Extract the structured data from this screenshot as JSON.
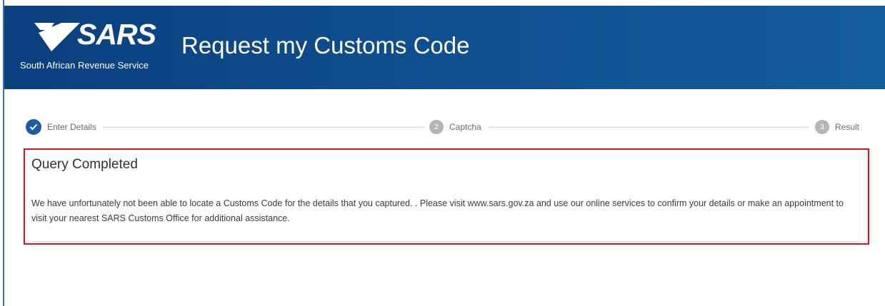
{
  "header": {
    "logo_text": "SARS",
    "org_name": "South African Revenue Service",
    "title": "Request my Customs Code"
  },
  "stepper": {
    "steps": [
      {
        "label": "Enter Details",
        "marker": "",
        "state": "completed"
      },
      {
        "label": "Captcha",
        "marker": "2",
        "state": "pending"
      },
      {
        "label": "Result",
        "marker": "3",
        "state": "pending"
      }
    ]
  },
  "message": {
    "title": "Query Completed",
    "body": "We have unfortunately not been able to locate a Customs Code for the details that you captured. . Please visit www.sars.gov.za and use our online services to confirm your details or make an appointment to visit your nearest SARS Customs Office for additional assistance."
  },
  "colors": {
    "header_bg": "#0f4e8f",
    "step_done": "#1d5ba3",
    "step_pending": "#b5b5b5",
    "highlight_border": "#e0131a"
  },
  "icons": {
    "completed_step": "checkmark-icon",
    "logo_mark": "sars-chevron-logo"
  }
}
